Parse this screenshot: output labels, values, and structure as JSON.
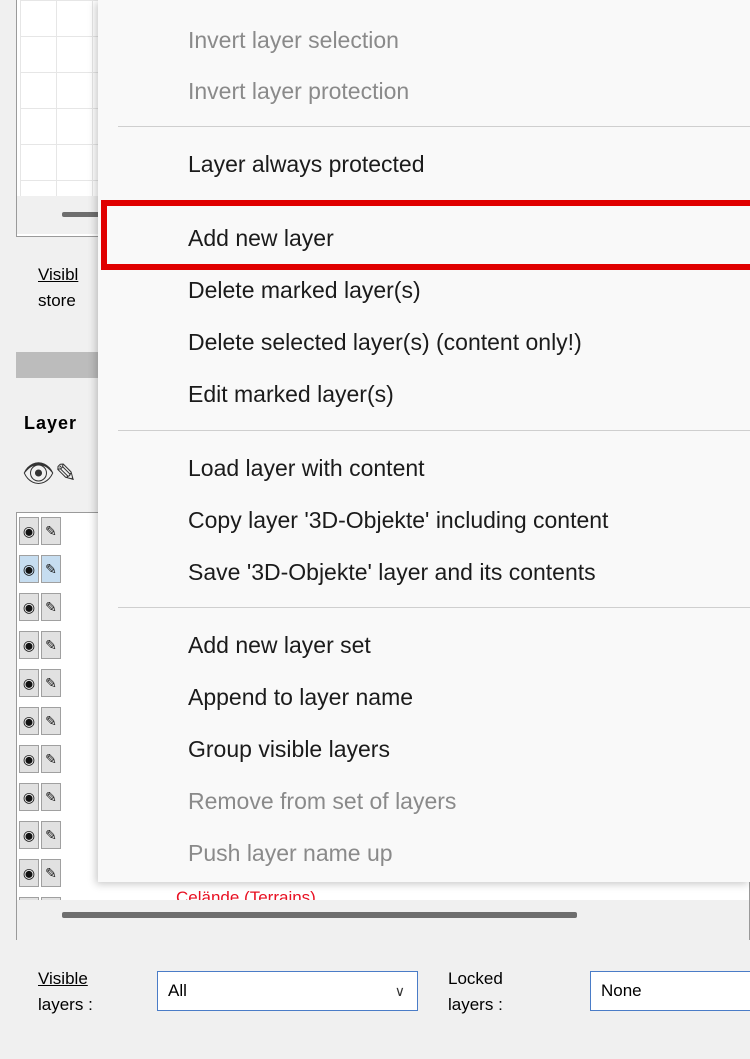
{
  "panel": {
    "visible_top_line1": "Visibl",
    "visible_top_line2": "store",
    "layers_heading": "Layer",
    "terrain_item": "Celände (Terrains)"
  },
  "icons": {
    "eye": "eye-icon",
    "pencil": "pencil-icon"
  },
  "layer_rows": [
    {
      "selected": false
    },
    {
      "selected": true
    },
    {
      "selected": false
    },
    {
      "selected": false
    },
    {
      "selected": false
    },
    {
      "selected": false
    },
    {
      "selected": false
    },
    {
      "selected": false
    },
    {
      "selected": false
    },
    {
      "selected": false
    },
    {
      "selected": false
    }
  ],
  "bottom": {
    "visible_label_1": "Visible",
    "visible_label_2": "layers :",
    "visible_value": "All",
    "locked_label_1": "Locked",
    "locked_label_2": "layers :",
    "locked_value": "None"
  },
  "context_menu": {
    "items": [
      {
        "label": "Invert layer selection",
        "enabled": false
      },
      {
        "label": "Invert layer protection",
        "enabled": false
      },
      {
        "label": "Layer always protected",
        "enabled": true
      },
      {
        "label": "Add new layer",
        "enabled": true,
        "highlighted": true
      },
      {
        "label": "Delete marked layer(s)",
        "enabled": true
      },
      {
        "label": "Delete selected layer(s) (content only!)",
        "enabled": true
      },
      {
        "label": "Edit marked layer(s)",
        "enabled": true
      },
      {
        "label": "Load layer with content",
        "enabled": true
      },
      {
        "label": "Copy layer '3D-Objekte' including content",
        "enabled": true
      },
      {
        "label": "Save '3D-Objekte'  layer and its contents",
        "enabled": true
      },
      {
        "label": "Add new layer set",
        "enabled": true
      },
      {
        "label": "Append to layer name",
        "enabled": true
      },
      {
        "label": "Group visible layers",
        "enabled": true
      },
      {
        "label": "Remove from set of layers",
        "enabled": false
      },
      {
        "label": "Push layer name up",
        "enabled": false
      }
    ]
  },
  "colors": {
    "highlight_border": "#e00000",
    "terrain_text": "#e81123",
    "combo_border": "#4a7cc7",
    "selected_row": "#c6ddf0"
  }
}
